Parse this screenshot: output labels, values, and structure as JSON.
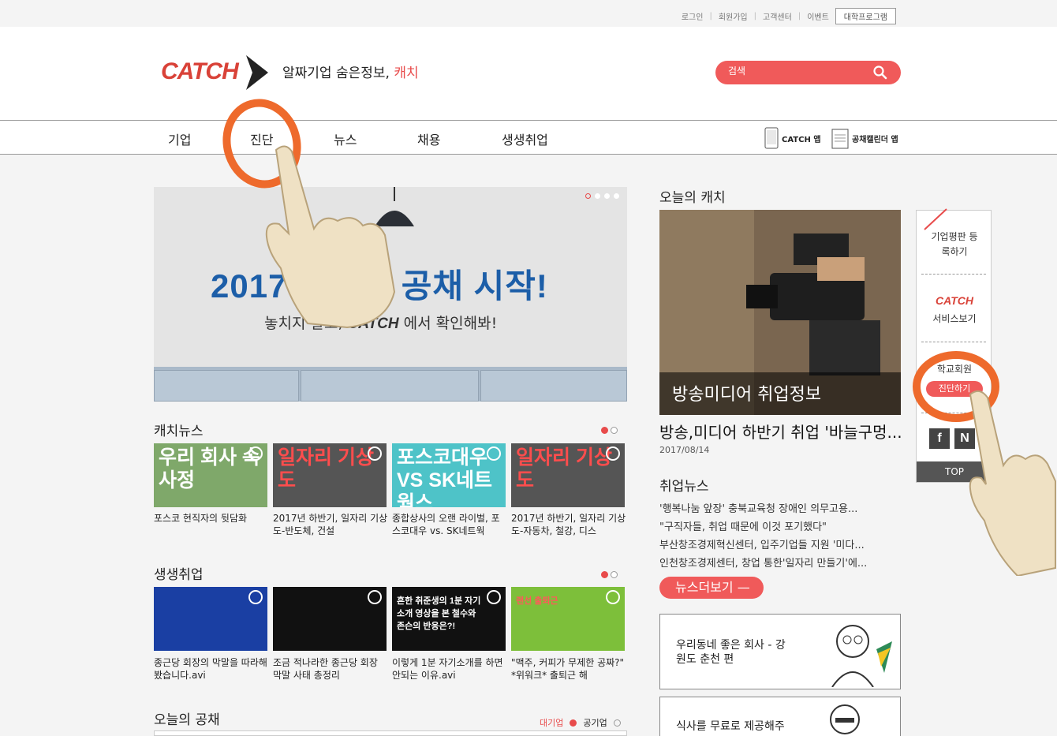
{
  "util": {
    "login": "로그인",
    "join": "회원가입",
    "support": "고객센터",
    "event": "이벤트",
    "college": "대학프로그램"
  },
  "header": {
    "logo": "CATCH",
    "tagline_main": "알짜기업 숨은정보,",
    "tagline_brand": "캐치"
  },
  "search": {
    "placeholder": "검색"
  },
  "nav": {
    "items": [
      "기업",
      "진단",
      "뉴스",
      "채용",
      "생생취업"
    ],
    "app1": "CATCH 앱",
    "app2": "공채캘린더 앱"
  },
  "banner": {
    "headline": "2017 하반기 공채 시작!",
    "sub_pre": "놓치지 말고,",
    "sub_brand": "CATCH",
    "sub_post": "에서 확인해봐!"
  },
  "catchnews": {
    "title": "캐치뉴스",
    "items": [
      {
        "thumb": "우리 회사 속사정",
        "caption": "포스코 현직자의 뒷담화",
        "bg": "#7fa86a",
        "color": "#fff"
      },
      {
        "thumb": "일자리 기상도",
        "caption": "2017년 하반기, 일자리 기상도-반도체, 건설",
        "bg": "#555555",
        "color": "#ff4d4d"
      },
      {
        "thumb": "포스코대우 VS SK네트웍스",
        "caption": "종합상사의 오랜 라이벌, 포스코대우 vs. SK네트웍",
        "bg": "#4ec3c8",
        "color": "#fff"
      },
      {
        "thumb": "일자리 기상도",
        "caption": "2017년 하반기, 일자리 기상도-자동차, 철강, 디스",
        "bg": "#555555",
        "color": "#ff4d4d"
      }
    ]
  },
  "saengsaeng": {
    "title": "생생취업",
    "items": [
      {
        "thumb": "",
        "caption": "종근당 회장의 막말을 따라해봤습니다.avi",
        "bg": "#1a3fa3",
        "color": "#fff"
      },
      {
        "thumb": "",
        "caption": "조금 적나라한 종근당 회장 막말 사태 총정리",
        "bg": "#111111",
        "color": "#fff"
      },
      {
        "thumb": "흔한 취준생의 1분 자기소개 영상을 본 철수와 존슨의 반응은?!",
        "caption": "이렇게 1분 자기소개를 하면 안되는 이유.avi",
        "bg": "#111111",
        "color": "#fff"
      },
      {
        "thumb": "랜선 출퇴근",
        "caption": "\"맥주, 커피가 무제한 공짜?\" *위워크* 출퇴근 해",
        "bg": "#7dbf3a",
        "color": "#ff5a5a"
      }
    ]
  },
  "jobs": {
    "title": "오늘의 공채",
    "tab1": "대기업",
    "tab2": "공기업"
  },
  "today": {
    "title": "오늘의 캐치",
    "image_label": "방송미디어 취업정보",
    "headline": "방송,미디어 하반기 취업 '바늘구멍...",
    "date": "2017/08/14"
  },
  "jobnews": {
    "title": "취업뉴스",
    "items": [
      "'행복나눔 앞장' 충북교육청 장애인 의무고용...",
      "\"구직자들, 취업 때문에 이것 포기했다\"",
      "부산창조경제혁신센터, 입주기업들 지원 '미다...",
      "인천창조경제센터, 창업 통한'일자리 만들기'에..."
    ],
    "more": "뉴스더보기"
  },
  "cards": [
    {
      "text": "우리동네 좋은 회사 - 강원도 춘천 편"
    },
    {
      "text": "식사를 무료로 제공해주"
    }
  ],
  "side": {
    "review": "기업평판 등록하기",
    "service_logo": "CATCH",
    "service": "서비스보기",
    "school": "학교회원",
    "diag": "진단하기",
    "top": "TOP"
  },
  "colors": {
    "accent": "#f05a5a",
    "brand_red": "#d94238"
  }
}
